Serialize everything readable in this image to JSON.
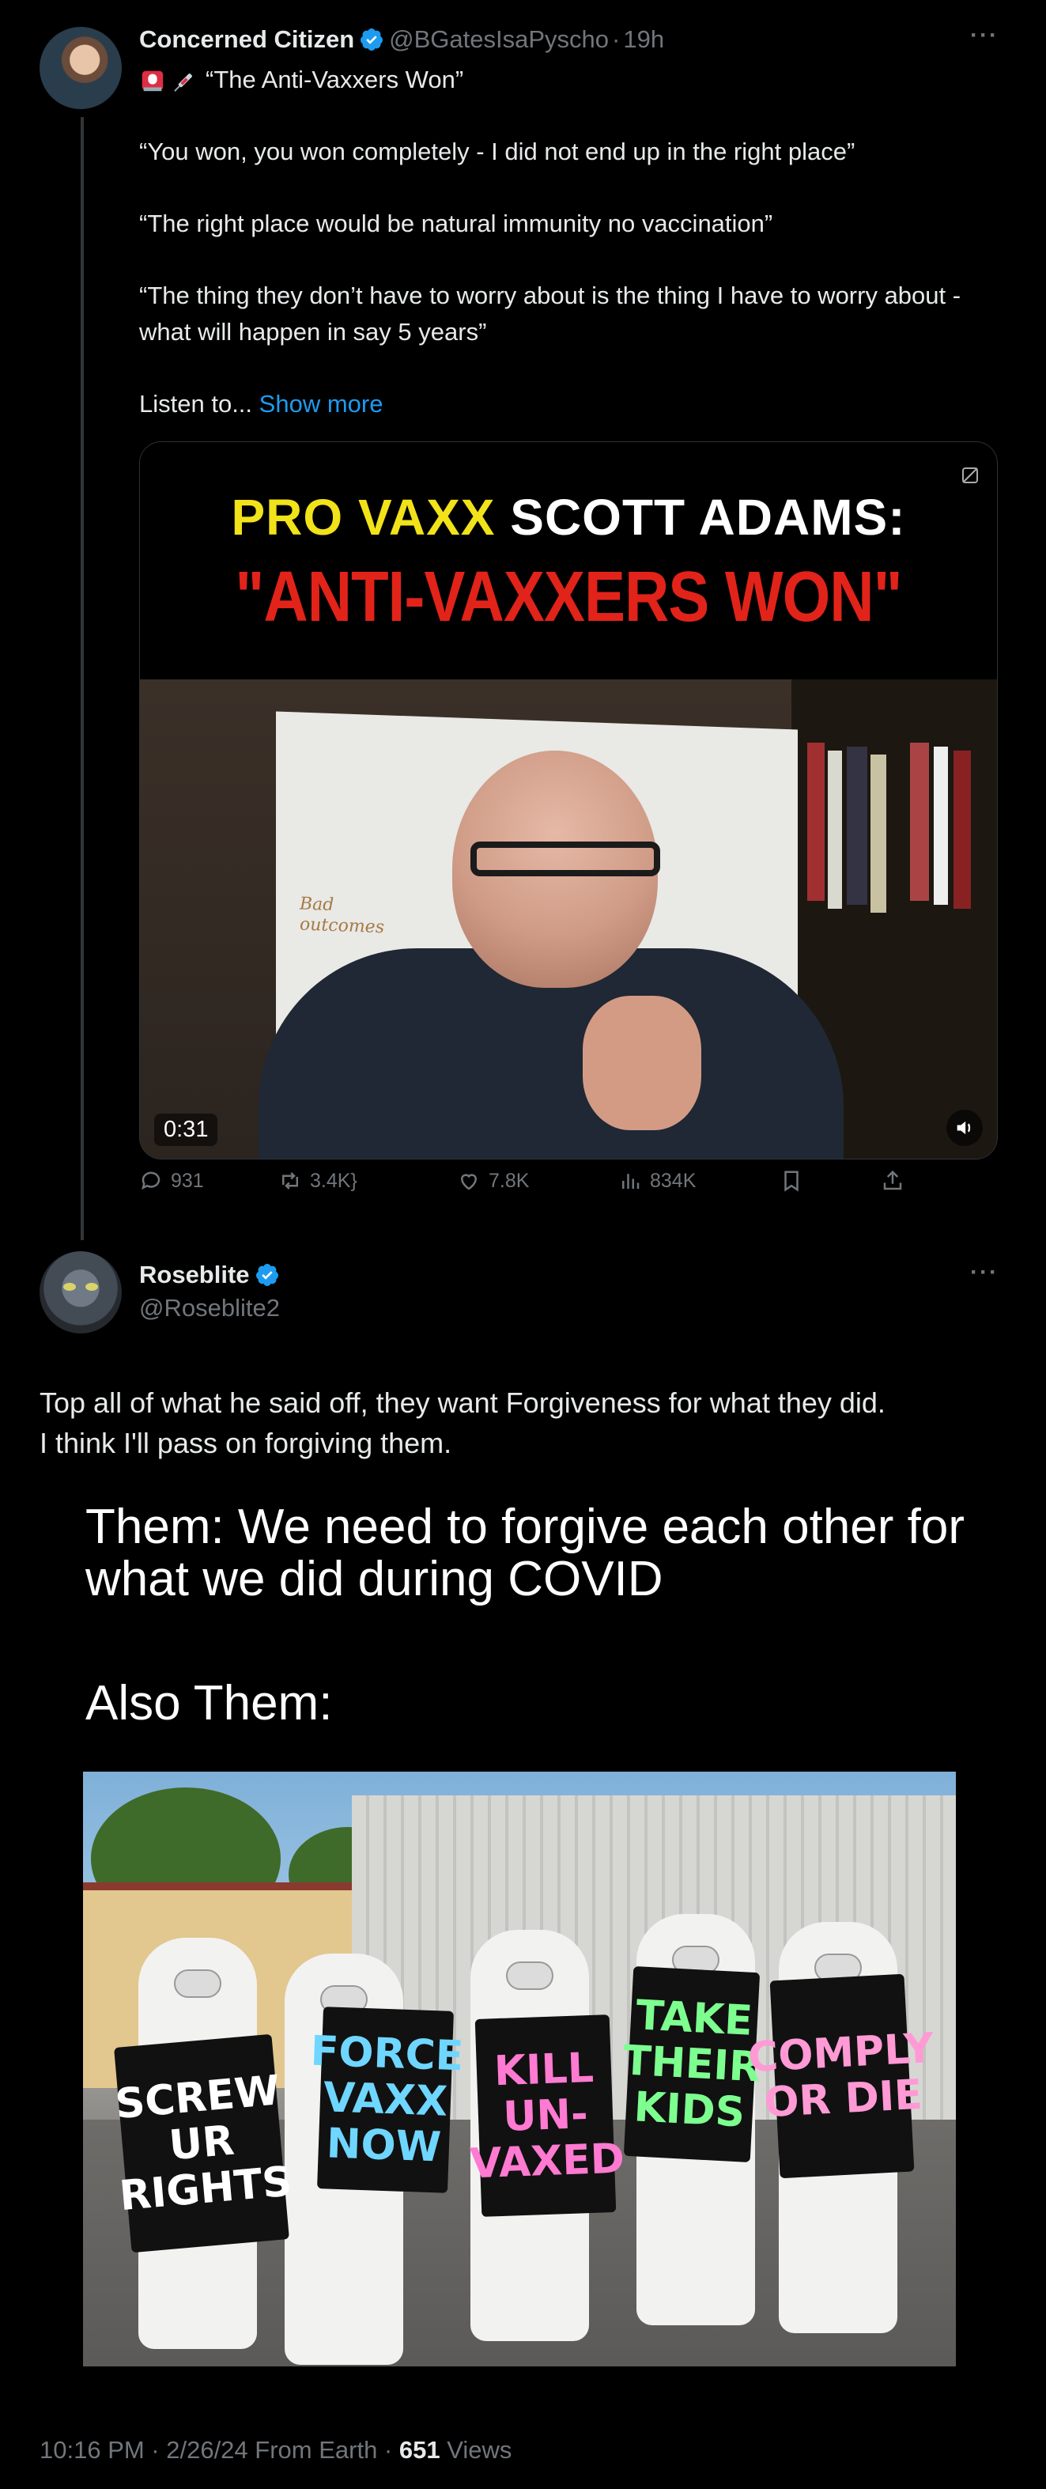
{
  "tweet1": {
    "author_name": "Concerned Citizen",
    "handle": "@BGatesIsaPyscho",
    "separator": "·",
    "time_ago": "19h",
    "more_label": "···",
    "title": "“The Anti-Vaxxers Won”",
    "paragraphs": [
      "“You won, you won completely - I did not end up in the right place”",
      "“The right place would be natural immunity no vaccination”",
      "“The thing they don’t have to worry about is the thing I have to worry about - what will happen in say 5 years”"
    ],
    "truncated_text": "Listen to...",
    "show_more": "Show more",
    "media": {
      "banner_line1_yellow": "PRO VAXX",
      "banner_line1_white": "SCOTT ADAMS:",
      "banner_line2": "\"ANTI-VAXXERS WON\"",
      "duration": "0:31"
    },
    "stats": {
      "replies": "931",
      "reposts": "3.4K",
      "likes": "7.8K",
      "views": "834K"
    }
  },
  "tweet2": {
    "author_name": "Roseblite",
    "handle": "@Roseblite2",
    "more_label": "···",
    "text_line1": "Top all of what he said off, they want Forgiveness for what they did.",
    "text_line2": "I think I'll pass on forgiving them.",
    "meme": {
      "line1": "Them: We need to forgive each other for what we did during COVID",
      "line2": "Also Them:",
      "signs": [
        "SCREW UR RIGHTS",
        "FORCE VAXX NOW",
        "KILL UN-VAXED",
        "TAKE THEIR KIDS",
        "COMPLY OR DIE"
      ]
    },
    "footer": {
      "time": "10:16 PM · 2/26/24 From Earth ·",
      "views_count": "651",
      "views_label": "Views"
    }
  },
  "colors": {
    "background": "#000000",
    "text": "#e7e9ea",
    "muted": "#71767b",
    "accent": "#1d9bf0"
  }
}
